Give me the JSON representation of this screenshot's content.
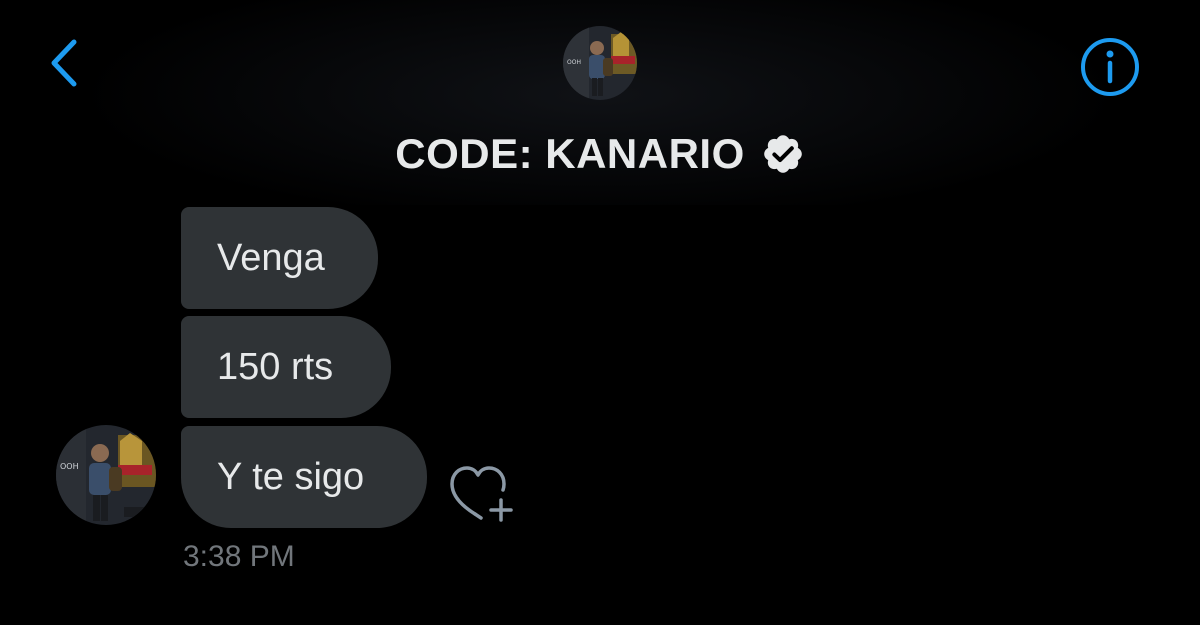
{
  "header": {
    "title": "CODE: KANARIO",
    "back_icon": "chevron-left-icon",
    "info_icon": "info-icon",
    "verified_icon": "verified-badge-icon",
    "accent_color": "#1d9bf0"
  },
  "messages": [
    {
      "text": "Venga"
    },
    {
      "text": "150 rts"
    },
    {
      "text": "Y te sigo"
    }
  ],
  "reaction_icon": "heart-add-icon",
  "timestamp": "3:38 PM",
  "colors": {
    "background": "#000000",
    "bubble": "#2f3336",
    "text": "#e7e9ea",
    "muted": "#71767b"
  }
}
